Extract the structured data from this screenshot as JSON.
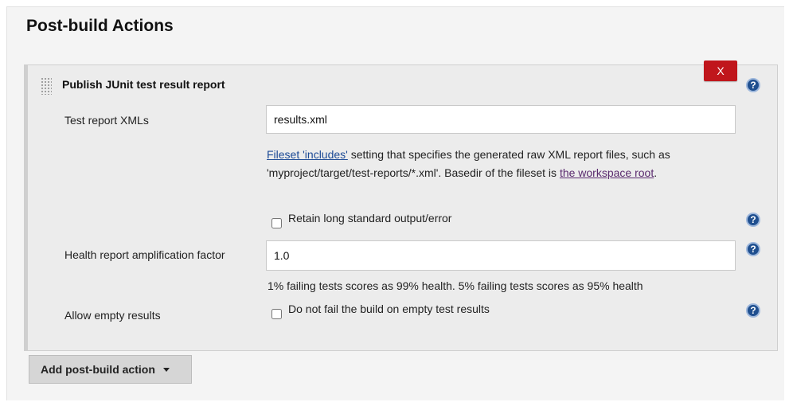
{
  "section": {
    "title": "Post-build Actions"
  },
  "panel": {
    "title": "Publish JUnit test result report",
    "delete_label": "X",
    "test_report": {
      "label": "Test report XMLs",
      "value": "results.xml",
      "desc_link1": "Fileset 'includes'",
      "desc_text1": " setting that specifies the generated raw XML report files, such as 'myproject/target/test-reports/*.xml'. Basedir of the fileset is ",
      "desc_link2": "the workspace root",
      "desc_text2": "."
    },
    "retain": {
      "label": "Retain long standard output/error",
      "checked": false
    },
    "health": {
      "label": "Health report amplification factor",
      "value": "1.0",
      "hint": "1% failing tests scores as 99% health. 5% failing tests scores as 95% health"
    },
    "allow_empty": {
      "label": "Allow empty results",
      "checkbox_label": "Do not fail the build on empty test results",
      "checked": false
    }
  },
  "footer": {
    "add_button_label": "Add post-build action"
  },
  "icons": {
    "help": "help-icon",
    "dropdown": "chevron-down-icon",
    "drag": "drag-handle-icon"
  },
  "colors": {
    "delete_button": "#c0161c",
    "link": "#1c4a96",
    "help_icon": "#1f4f8f"
  }
}
